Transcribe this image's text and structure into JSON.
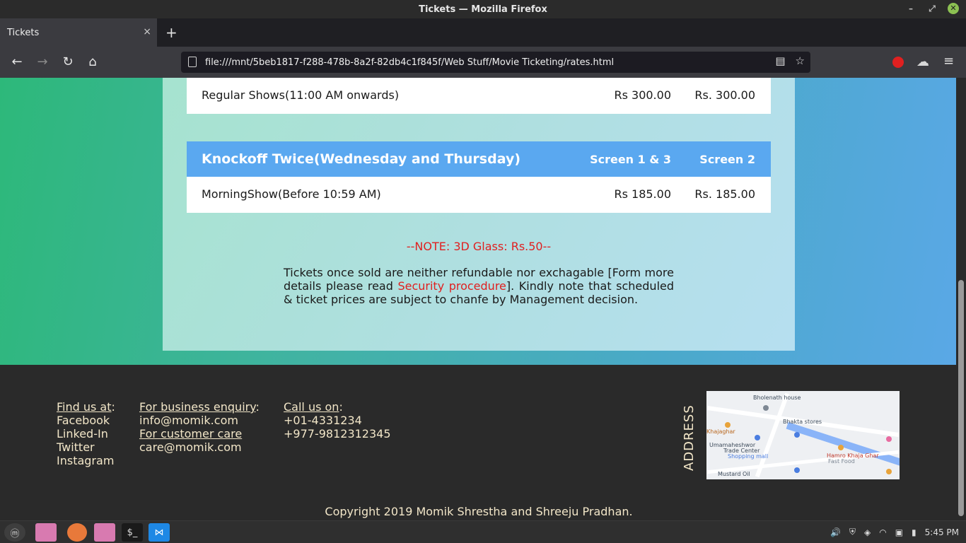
{
  "window": {
    "title": "Tickets — Mozilla Firefox"
  },
  "tab": {
    "label": "Tickets",
    "close": "×",
    "new_tab": "+"
  },
  "nav": {
    "url": "file:///mnt/5beb1817-f288-478b-8a2f-82db4c1f845f/Web Stuff/Movie Ticketing/rates.html"
  },
  "rates": {
    "regular": {
      "name": "Regular Shows(11:00 AM onwards)",
      "price1": "Rs 300.00",
      "price2": "Rs. 300.00"
    },
    "knockoff": {
      "title": "Knockoff Twice(Wednesday and Thursday)",
      "screen1": "Screen 1 & 3",
      "screen2": "Screen 2"
    },
    "morning": {
      "name": "MorningShow(Before 10:59 AM)",
      "price1": "Rs 185.00",
      "price2": "Rs. 185.00"
    },
    "note": "--NOTE: 3D Glass: Rs.50--",
    "policy_before": "Tickets once sold are neither refundable nor exchagable [Form more details please read ",
    "policy_link": "Security procedure",
    "policy_after": "]. Kindly note that scheduled & ticket prices are subject to chanfe by Management decision."
  },
  "footer": {
    "find_heading": "Find us at",
    "find_colon": ":",
    "social": [
      "Facebook",
      "Linked-In",
      "Twitter",
      "Instagram"
    ],
    "business_heading": "For business enquiry",
    "business_colon": ":",
    "business_email": "info@momik.com",
    "care_heading": "For customer care",
    "care_email": "care@momik.com",
    "call_heading": "Call us on",
    "call_colon": ":",
    "phones": [
      "+01-4331234",
      "+977-9812312345"
    ],
    "address_label": "ADDRESS",
    "copyright": "Copyright 2019 Momik Shrestha and Shreeju Pradhan."
  },
  "map": {
    "labels": [
      "Bholenath house",
      "Bhakta stores",
      "Khajaghar",
      "Umamaheshwor",
      "Trade Center",
      "Shopping mall",
      "Hamro Khaja Ghar",
      "Fast Food",
      "Mustard Oil"
    ]
  },
  "taskbar": {
    "clock": "5:45 PM"
  }
}
